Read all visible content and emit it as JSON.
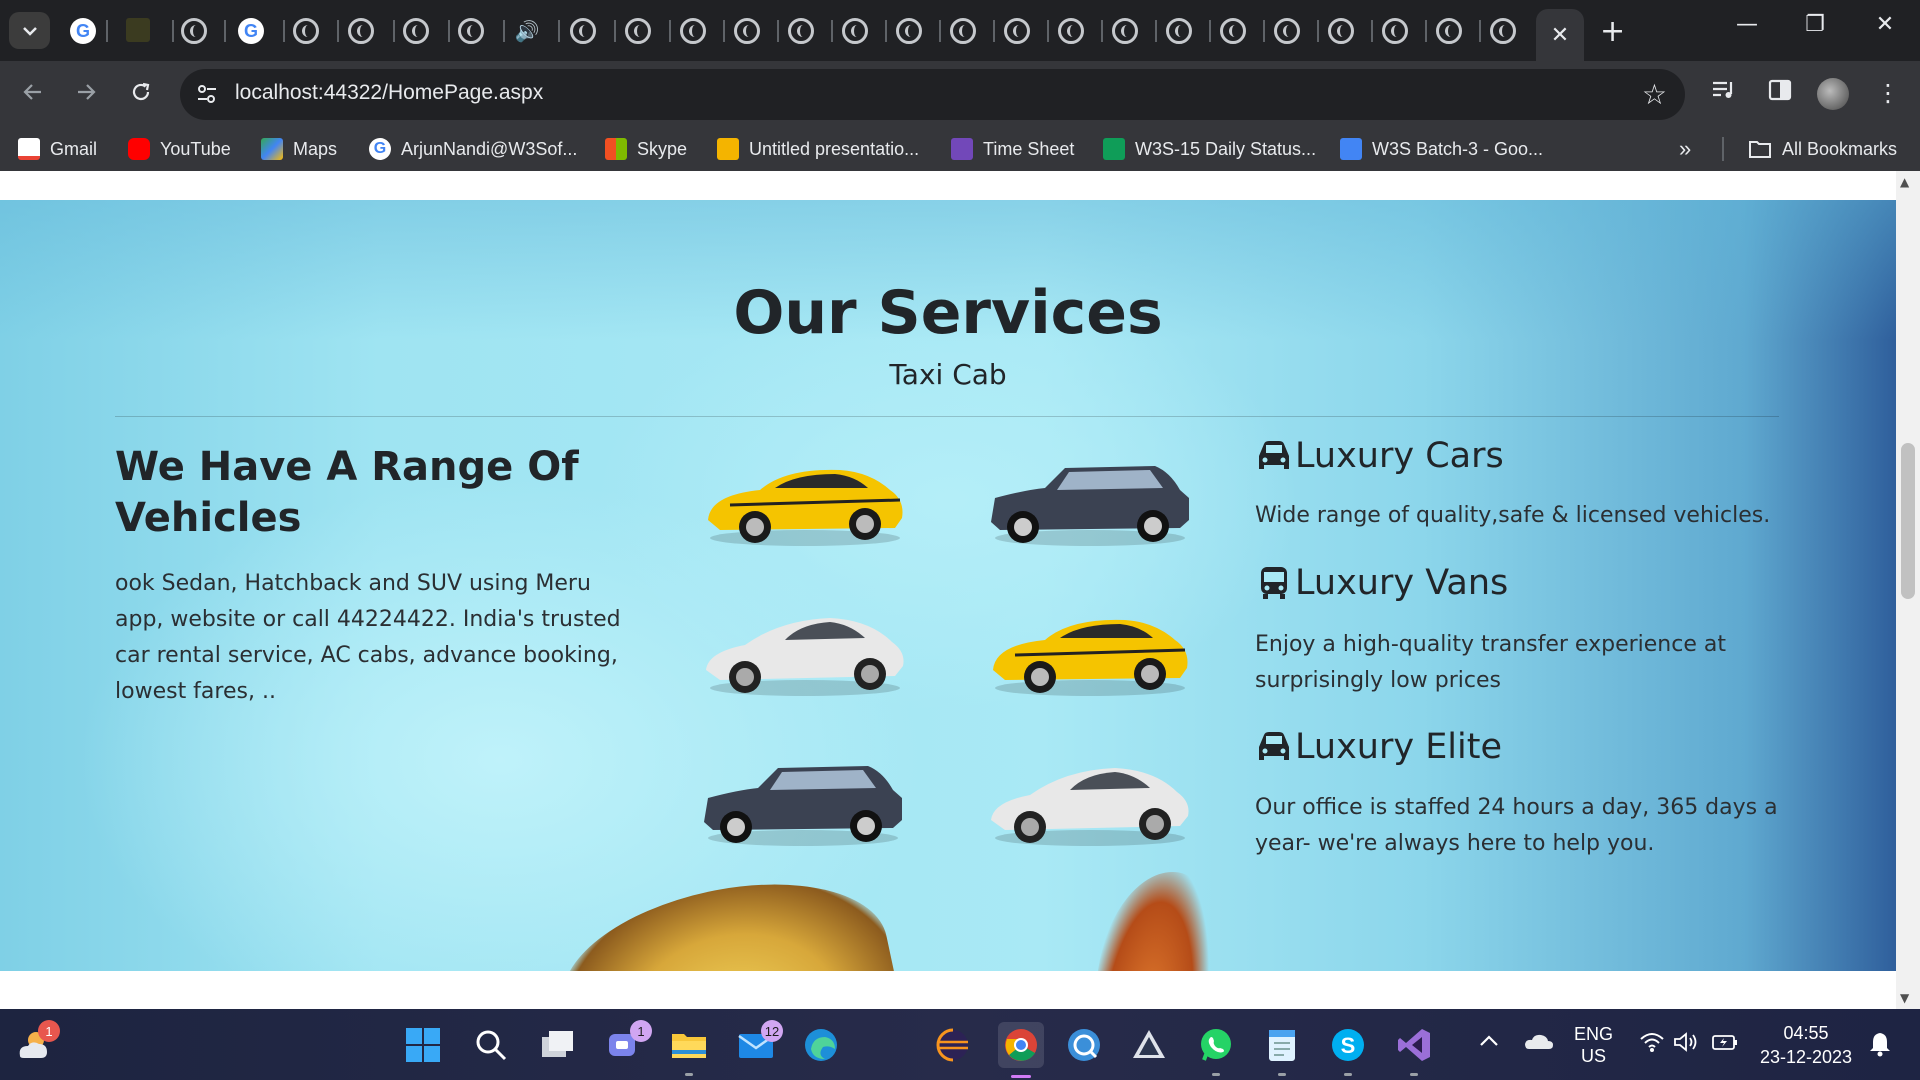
{
  "browser": {
    "url": "localhost:44322/HomePage.aspx",
    "active_tab_close": "✕",
    "new_tab": "+",
    "window": {
      "minimize": "—",
      "restore": "❐",
      "close": "✕"
    }
  },
  "bookmarks": [
    {
      "label": "Gmail",
      "color": "#ea4335"
    },
    {
      "label": "YouTube",
      "color": "#ff0000"
    },
    {
      "label": "Maps",
      "color": "#34a853"
    },
    {
      "label": "ArjunNandi@W3Sof...",
      "color": "#4285f4"
    },
    {
      "label": "Skype",
      "color": "#f25022"
    },
    {
      "label": "Untitled presentatio...",
      "color": "#f4b400"
    },
    {
      "label": "Time Sheet",
      "color": "#7248b9"
    },
    {
      "label": "W3S-15 Daily Status...",
      "color": "#0f9d58"
    },
    {
      "label": "W3S Batch-3 - Goo...",
      "color": "#4285f4"
    }
  ],
  "bookmarks_more": "»",
  "all_bookmarks": "All Bookmarks",
  "page": {
    "title": "Our Services",
    "subtitle": "Taxi Cab",
    "range_title": "We Have A Range Of Vehicles",
    "range_text": "ook Sedan, Hatchback and SUV using Meru app, website or call 44224422. India's trusted car rental service, AC cabs, advance booking, lowest fares, ..",
    "features": [
      {
        "title": "Luxury Cars",
        "text": "Wide range of quality,safe & licensed vehicles.",
        "icon": "car-icon"
      },
      {
        "title": "Luxury Vans",
        "text": "Enjoy a high-quality transfer experience at surprisingly low prices",
        "icon": "bus-icon"
      },
      {
        "title": "Luxury Elite",
        "text": "Our office is staffed 24 hours a day, 365 days a year- we're always here to help you.",
        "icon": "car-icon"
      }
    ],
    "cars": [
      "yellow-sports-car",
      "dark-suv",
      "white-coupe",
      "yellow-sports-car",
      "dark-suv",
      "white-coupe"
    ]
  },
  "taskbar": {
    "weather_badge": "1",
    "teams_badge": "1",
    "mail_badge": "12",
    "lang_top": "ENG",
    "lang_bottom": "US",
    "time": "04:55",
    "date": "23-12-2023"
  }
}
